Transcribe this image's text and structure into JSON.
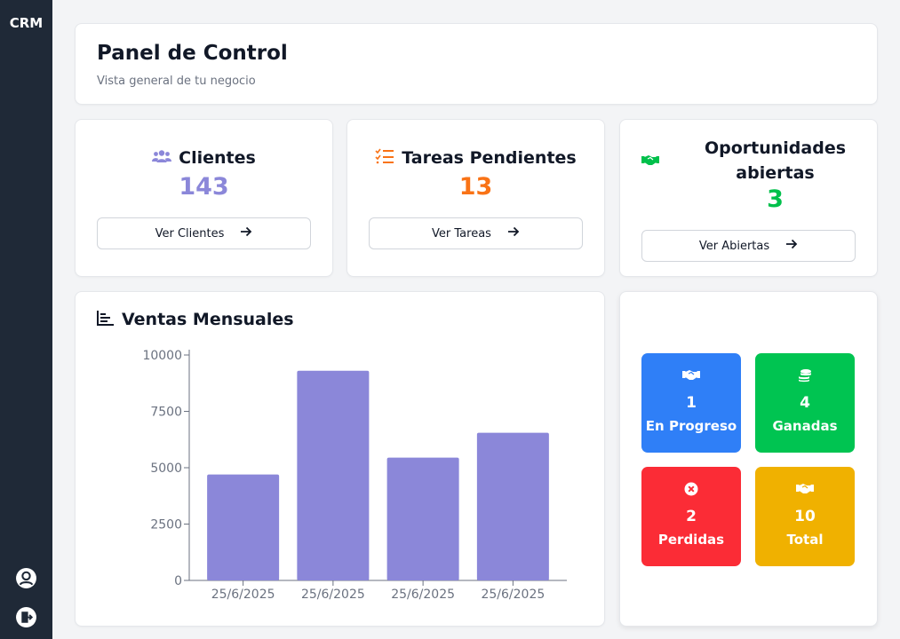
{
  "app": {
    "logo": "CRM"
  },
  "sidebar": {
    "icons": [
      "user-circle-icon",
      "logout-icon"
    ]
  },
  "header": {
    "title": "Panel de Control",
    "subtitle": "Vista general de tu negocio"
  },
  "stats": [
    {
      "icon": "users-icon",
      "title": "Clientes",
      "value": "143",
      "button": "Ver Clientes",
      "color": "#8b87d9"
    },
    {
      "icon": "tasks-icon",
      "title": "Tareas Pendientes",
      "value": "13",
      "button": "Ver Tareas",
      "color": "#f97316"
    },
    {
      "icon": "handshake-icon",
      "title_line1": "Oportunidades",
      "title_line2": "abiertas",
      "value": "3",
      "button": "Ver Abiertas",
      "color": "#00c04b"
    }
  ],
  "chart": {
    "title": "Ventas Mensuales",
    "icon": "bar-chart-icon"
  },
  "chart_data": {
    "type": "bar",
    "title": "Ventas Mensuales",
    "xlabel": "",
    "ylabel": "",
    "categories": [
      "25/6/2025",
      "25/6/2025",
      "25/6/2025",
      "25/6/2025"
    ],
    "values": [
      4700,
      9300,
      5450,
      6550
    ],
    "ylim": [
      0,
      10000
    ],
    "yticks": [
      0,
      2500,
      5000,
      7500,
      10000
    ],
    "bar_color": "#8b87d9",
    "grid": false
  },
  "summary": [
    {
      "icon": "handshake-icon",
      "value": "1",
      "label": "En Progreso",
      "color": "#2f7ff7"
    },
    {
      "icon": "coins-icon",
      "value": "4",
      "label": "Ganadas",
      "color": "#00c451"
    },
    {
      "icon": "x-circle-icon",
      "value": "2",
      "label": "Perdidas",
      "color": "#fb2c36"
    },
    {
      "icon": "handshake-icon",
      "value": "10",
      "label": "Total",
      "color": "#f0b100"
    }
  ]
}
